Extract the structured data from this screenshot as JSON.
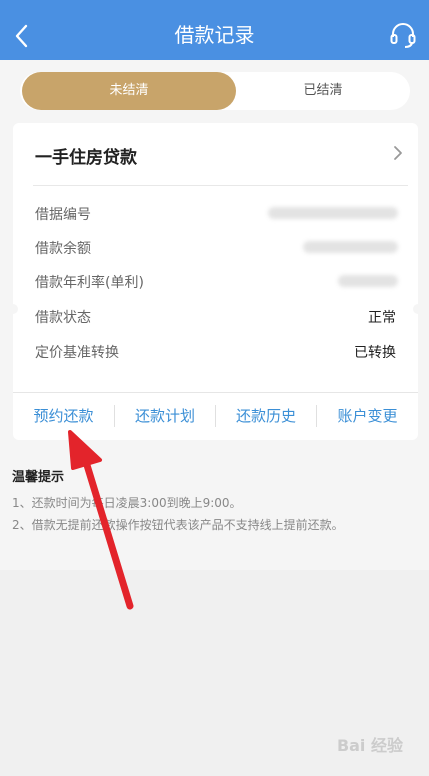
{
  "header": {
    "title": "借款记录",
    "back_icon": "chevron-left-icon",
    "service_icon": "headset-icon",
    "color": "#4a90e2"
  },
  "tabs": [
    {
      "label": "未结清",
      "active": true
    },
    {
      "label": "已结清",
      "active": false
    }
  ],
  "loan": {
    "title": "一手住房贷款",
    "rows": [
      {
        "label": "借据编号",
        "value": "",
        "blurred": true
      },
      {
        "label": "借款余额",
        "value": "",
        "blurred": true
      },
      {
        "label": "借款年利率(单利)",
        "value": "",
        "blurred": true
      },
      {
        "label": "借款状态",
        "value": "正常",
        "blurred": false
      },
      {
        "label": "定价基准转换",
        "value": "已转换",
        "blurred": false
      }
    ],
    "actions": [
      "预约还款",
      "还款计划",
      "还款历史",
      "账户变更"
    ]
  },
  "tips": {
    "title": "温馨提示",
    "items": [
      "1、还款时间为每日凌晨3:00到晚上9:00。",
      "2、借款无提前还款操作按钮代表该产品不支持线上提前还款。"
    ]
  },
  "watermark": "Bai 经验",
  "colors": {
    "accent_gold": "#c8a46a",
    "link_blue": "#3b8fd6",
    "annotation_red": "#e3242b"
  }
}
